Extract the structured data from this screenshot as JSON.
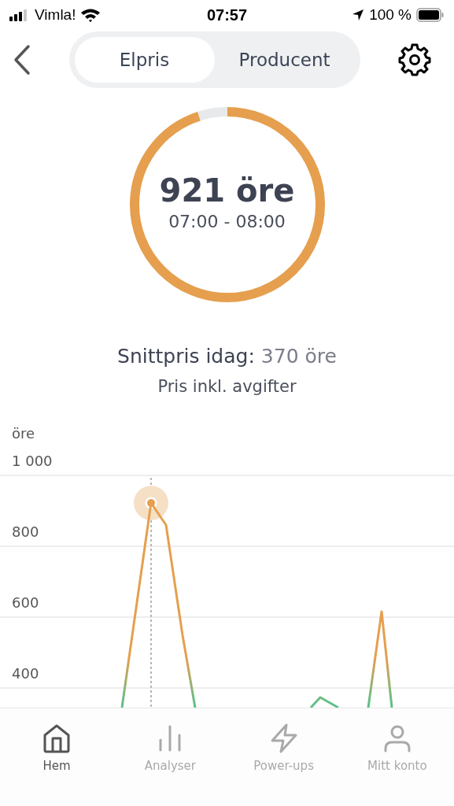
{
  "status_bar": {
    "carrier": "Vimla!",
    "time": "07:57",
    "battery": "100 %"
  },
  "segments": [
    {
      "label": "Elpris",
      "selected": true
    },
    {
      "label": "Producent",
      "selected": false
    }
  ],
  "price_ring": {
    "value": "921 öre",
    "period": "07:00 - 08:00",
    "level": 0.95
  },
  "average": {
    "label": "Snittpris idag:",
    "value": "370 öre"
  },
  "note": "Pris inkl. avgifter",
  "chart": {
    "unit": "öre",
    "y_labels": [
      "1 000",
      "800",
      "600",
      "400"
    ]
  },
  "tab_bar": [
    {
      "label": "Hem",
      "selected": true
    },
    {
      "label": "Analyser",
      "selected": false
    },
    {
      "label": "Power-ups",
      "selected": false
    },
    {
      "label": "Mitt konto",
      "selected": false
    }
  ]
}
